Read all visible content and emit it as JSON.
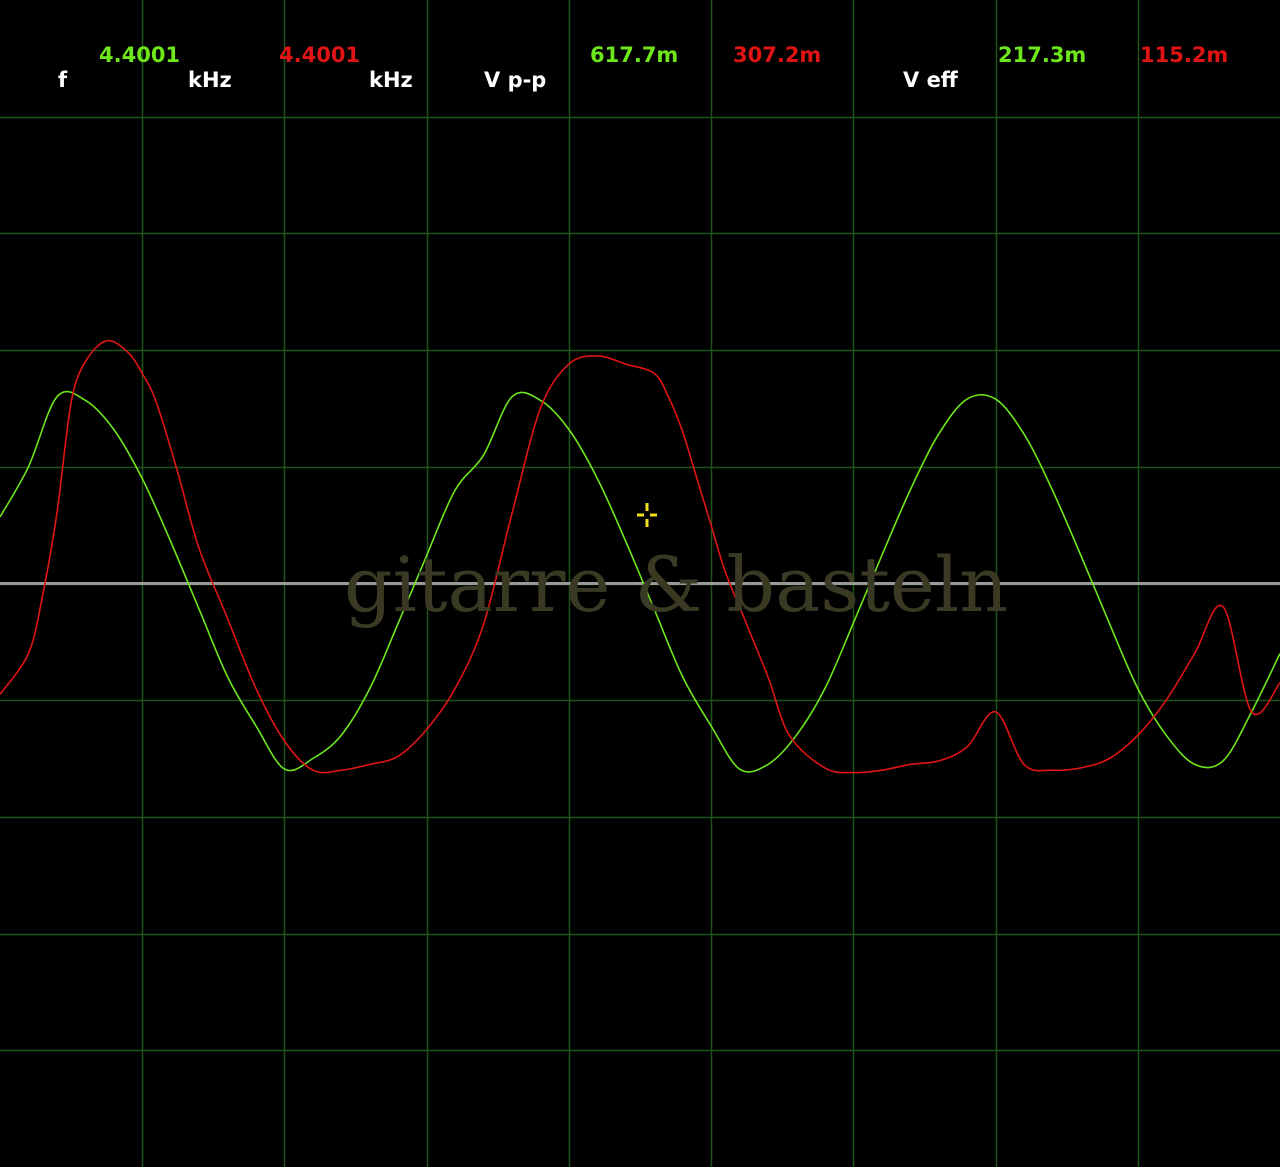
{
  "readouts": {
    "f_label": "f",
    "ch1_frequency": "4.4001",
    "ch1_frequency_unit": "kHz",
    "ch2_frequency": "4.4001",
    "ch2_frequency_unit": "kHz",
    "vpp_label": "V p-p",
    "ch1_vpp": "617.7m",
    "ch2_vpp": "307.2m",
    "veff_label": "V eff",
    "ch1_veff": "217.3m",
    "ch2_veff": "115.2m"
  },
  "watermark": "gitarre & basteln",
  "colors": {
    "background": "#000000",
    "grid": "#1c5418",
    "baseline": "#9a9a9a",
    "channel1": "#6ee61c",
    "channel2": "#e01414",
    "label": "#ffffff",
    "cursor": "#f0e020"
  },
  "chart_data": {
    "type": "line",
    "title": "",
    "xlabel": "",
    "ylabel": "",
    "grid": true,
    "grid_divisions": {
      "x": 9,
      "y": 10
    },
    "xlim": [
      0,
      9
    ],
    "ylim": [
      -5,
      5
    ],
    "series": [
      {
        "name": "",
        "color": "#6ee61c",
        "x": [
          0,
          0.2,
          0.4,
          0.6,
          0.8,
          1.0,
          1.2,
          1.4,
          1.6,
          1.8,
          2.0,
          2.2,
          2.4,
          2.6,
          2.8,
          3.0,
          3.2,
          3.4,
          3.6,
          3.8,
          4.0,
          4.2,
          4.4,
          4.6,
          4.8,
          5.0,
          5.2,
          5.4,
          5.6,
          5.8,
          6.0,
          6.2,
          6.4,
          6.6,
          6.8,
          7.0,
          7.2,
          7.4,
          7.6,
          7.8,
          8.0,
          8.2,
          8.4,
          8.6,
          8.8,
          9.0
        ],
        "y": [
          0.57,
          1.0,
          1.6,
          1.57,
          1.32,
          0.9,
          0.36,
          -0.22,
          -0.8,
          -1.22,
          -1.59,
          -1.5,
          -1.3,
          -0.9,
          -0.34,
          0.24,
          0.8,
          1.1,
          1.6,
          1.57,
          1.32,
          0.9,
          0.36,
          -0.22,
          -0.8,
          -1.22,
          -1.59,
          -1.55,
          -1.3,
          -0.9,
          -0.34,
          0.24,
          0.8,
          1.28,
          1.58,
          1.58,
          1.28,
          0.8,
          0.24,
          -0.34,
          -0.9,
          -1.3,
          -1.55,
          -1.52,
          -1.1,
          -0.6
        ]
      },
      {
        "name": "",
        "color": "#e01414",
        "x": [
          0,
          0.2,
          0.3,
          0.4,
          0.5,
          0.6,
          0.75,
          0.9,
          1.0,
          1.1,
          1.25,
          1.4,
          1.6,
          1.8,
          2.0,
          2.2,
          2.4,
          2.6,
          2.8,
          3.0,
          3.2,
          3.4,
          3.6,
          3.8,
          4.0,
          4.2,
          4.4,
          4.6,
          4.7,
          4.8,
          4.9,
          5.0,
          5.1,
          5.25,
          5.4,
          5.55,
          5.8,
          6.0,
          6.2,
          6.4,
          6.6,
          6.8,
          7.0,
          7.2,
          7.4,
          7.6,
          7.8,
          8.0,
          8.2,
          8.4,
          8.6,
          8.8,
          9.0
        ],
        "y": [
          -0.95,
          -0.6,
          -0.1,
          0.6,
          1.55,
          1.9,
          2.08,
          1.98,
          1.8,
          1.55,
          0.95,
          0.3,
          -0.3,
          -0.9,
          -1.35,
          -1.6,
          -1.6,
          -1.55,
          -1.48,
          -1.25,
          -0.9,
          -0.35,
          0.6,
          1.5,
          1.88,
          1.95,
          1.88,
          1.8,
          1.6,
          1.3,
          0.9,
          0.5,
          0.1,
          -0.35,
          -0.8,
          -1.3,
          -1.58,
          -1.62,
          -1.6,
          -1.55,
          -1.52,
          -1.4,
          -1.1,
          -1.55,
          -1.6,
          -1.58,
          -1.5,
          -1.3,
          -1.0,
          -0.6,
          -0.2,
          -1.1,
          -0.85
        ]
      }
    ]
  }
}
